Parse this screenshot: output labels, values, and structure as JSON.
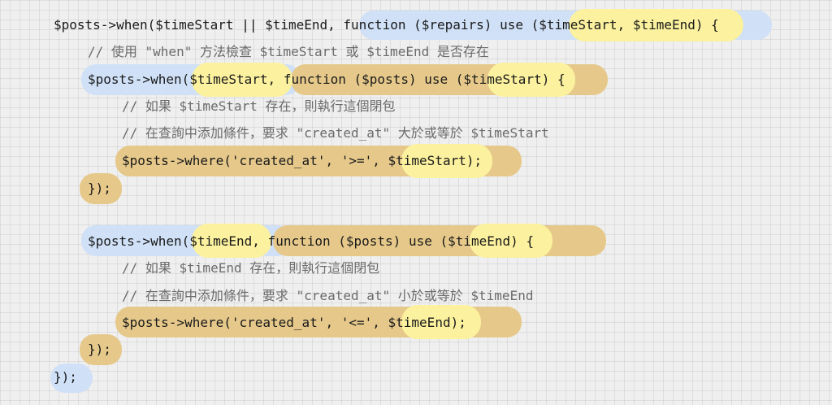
{
  "code_lines": [
    "$posts->when($timeStart || $timeEnd, function ($repairs) use ($timeStart, $timeEnd) {",
    "// 使用 \"when\" 方法檢查 $timeStart 或 $timeEnd 是否存在",
    "$posts->when($timeStart, function ($posts) use ($timeStart) {",
    "// 如果 $timeStart 存在，則執行這個閉包",
    "// 在查詢中添加條件，要求 \"created_at\" 大於或等於 $timeStart",
    "$posts->where('created_at', '>=', $timeStart);",
    "});",
    "$posts->when($timeEnd, function ($posts) use ($timeEnd) {",
    "// 如果 $timeEnd 存在，則執行這個閉包",
    "// 在查詢中添加條件，要求 \"created_at\" 小於或等於 $timeEnd",
    "$posts->where('created_at', '<=', $timeEnd);",
    "});",
    "});"
  ],
  "colors": {
    "outer_scope": "#cfe0f7",
    "closure_scope": "#e6c98a",
    "captured_variable": "#fbf19e",
    "comment_text": "#6b6b6b",
    "code_text": "#1a1a1a",
    "background": "#efefef"
  }
}
